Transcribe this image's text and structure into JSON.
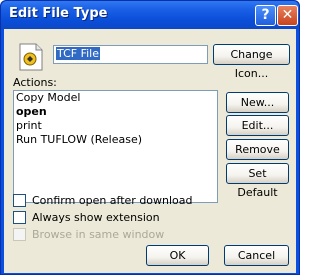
{
  "window": {
    "title": "Edit File Type",
    "help_glyph": "?",
    "close_glyph": "✕"
  },
  "file_type": {
    "name_value": "TCF File",
    "change_icon_label": "Change Icon..."
  },
  "actions": {
    "label": "Actions:",
    "items": [
      {
        "label": "Copy Model",
        "bold": false
      },
      {
        "label": "open",
        "bold": true
      },
      {
        "label": "print",
        "bold": false
      },
      {
        "label": "Run TUFLOW (Release)",
        "bold": false
      }
    ],
    "buttons": {
      "new": "New...",
      "edit": "Edit...",
      "remove": "Remove",
      "set_default": "Set Default"
    }
  },
  "options": {
    "confirm_open": {
      "label": "Confirm open after download",
      "checked": false
    },
    "always_show_ext": {
      "label": "Always show extension",
      "checked": false
    },
    "browse_same_window": {
      "label": "Browse in same window",
      "checked": false,
      "disabled": true
    }
  },
  "footer": {
    "ok": "OK",
    "cancel": "Cancel"
  },
  "colors": {
    "title_bar": "#0a4ed8",
    "dialog_face": "#ece9d8",
    "selection": "#316ac5"
  }
}
